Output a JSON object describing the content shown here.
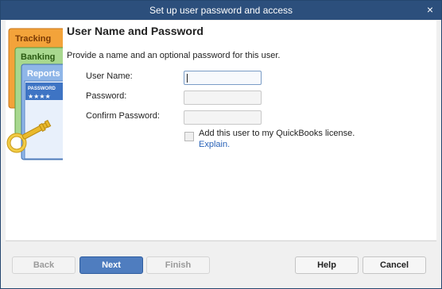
{
  "window": {
    "title": "Set up user password and access",
    "close_glyph": "×"
  },
  "sidebar_art": {
    "tab1": "Tracking",
    "tab2": "Banking",
    "tab3": "Reports",
    "strip": "PASSWORD",
    "stars": "★★★★",
    "icon": "key-icon"
  },
  "page": {
    "heading": "User Name and Password",
    "instructions": "Provide a name and an optional password for this user.",
    "fields": {
      "username_label": "User Name:",
      "username_value": "",
      "password_label": "Password:",
      "password_value": "",
      "confirm_label": "Confirm Password:",
      "confirm_value": ""
    },
    "license": {
      "checked": false,
      "label": "Add this user to my QuickBooks license.",
      "link": "Explain."
    }
  },
  "buttons": {
    "back": "Back",
    "next": "Next",
    "finish": "Finish",
    "help": "Help",
    "cancel": "Cancel"
  },
  "colors": {
    "titlebar": "#2c4f7c",
    "primary_button": "#4f7dbf",
    "link": "#2a63b8"
  }
}
